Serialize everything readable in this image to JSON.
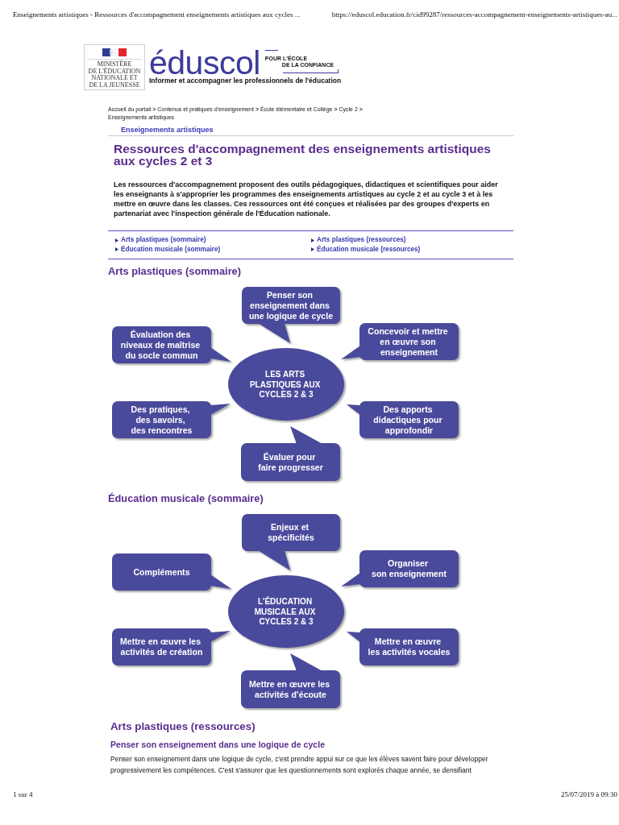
{
  "print_header": {
    "title": "Enseignements artistiques - Ressources d'accompagnement enseignements artistiques aux cycles ...",
    "url": "https://eduscol.education.fr/cid99287/ressources-accompagnement-enseignements-artistiques-au..."
  },
  "logo": {
    "ministry": "MINISTÈRE\nDE L'ÉDUCATION\nNATIONALE ET\nDE LA JEUNESSE",
    "brand": "éduscol",
    "tagline": [
      "POUR L'ÉCOLE",
      "DE LA CONFIANCE"
    ],
    "slogan": "Informer et accompagner les professionnels de l'éducation"
  },
  "breadcrumb": {
    "separator": ">",
    "items": [
      "Accueil du portail",
      "Contenus et pratiques d'enseignement",
      "École élémentaire et Collège",
      "Cycle 2",
      "Enseignements artistiques"
    ]
  },
  "section_label": "Enseignements artistiques",
  "title": "Ressources d'accompagnement des enseignements artistiques aux cycles 2 et 3",
  "intro": "Les ressources d'accompagnement proposent des outils pédagogiques, didactiques et scientifiques pour aider les enseignants à s'approprier les programmes des enseignements artistiques au cycle 2 et au cycle 3 et à les mettre en œuvre dans les classes. Ces ressources ont été conçues et réalisées par des groupes d'experts en partenariat avec l'inspection générale de l'Éducation nationale.",
  "links": [
    "Arts plastiques (sommaire)",
    "Arts plastiques (ressources)",
    "Éducation musicale (sommaire)",
    "Éducation musicale (ressources)"
  ],
  "diagrams": [
    {
      "heading": "Arts plastiques (sommaire)",
      "center": "LES ARTS\nPLASTIQUES AUX\nCYCLES 2 & 3",
      "bubbles": [
        "Penser son\nenseignement dans\nune logique de cycle",
        "Évaluation des\nniveaux de maîtrise\ndu socle commun",
        "Concevoir et mettre\nen œuvre son\nenseignement",
        "Des pratiques,\ndes savoirs,\ndes rencontres",
        "Des apports\ndidactiques pour\napprofondir",
        "Évaluer pour\nfaire progresser"
      ]
    },
    {
      "heading": "Éducation musicale (sommaire)",
      "center": "L’ÉDUCATION\nMUSICALE AUX\nCYCLES 2 & 3",
      "bubbles": [
        "Enjeux et\nspécificités",
        "Compléments",
        "Organiser\nson enseignement",
        "Mettre en œuvre les\nactivités de création",
        "Mettre en œuvre\nles activités vocales",
        "Mettre en œuvre les\nactivités d’écoute"
      ]
    }
  ],
  "resources": {
    "heading": "Arts plastiques (ressources)",
    "subheading": "Penser son enseignement dans une logique de cycle",
    "text": "Penser son enseignement dans une logique de cycle, c'est prendre appui sur ce que les élèves savent faire pour développer progressivement les compétences. C'est s'assurer que les questionnements sont explorés chaque année, se densifiant"
  },
  "print_footer": {
    "page": "1 sur 4",
    "date": "25/07/2019 à 09:30"
  }
}
